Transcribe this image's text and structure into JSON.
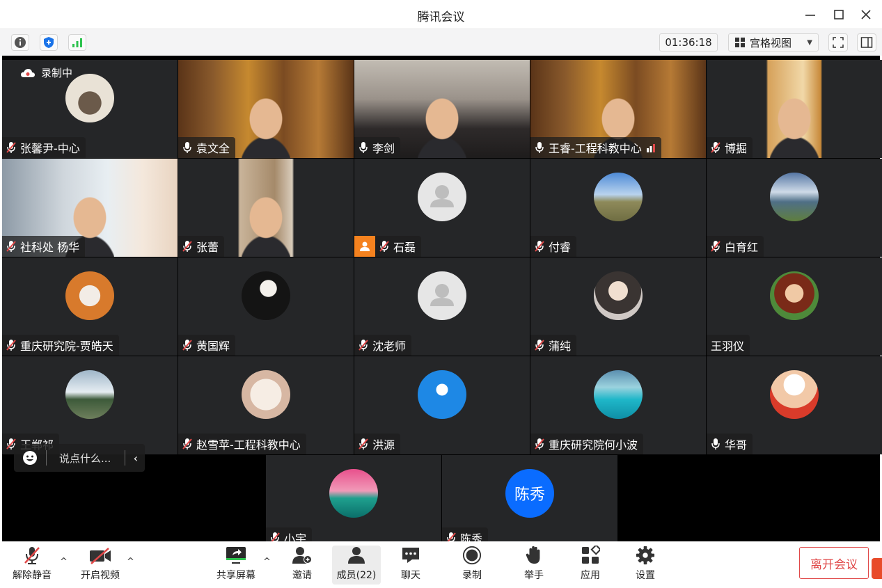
{
  "window": {
    "title": "腾讯会议"
  },
  "infobar": {
    "timer": "01:36:18",
    "view_label": "宫格视图"
  },
  "recording": {
    "label": "录制中"
  },
  "tiles": [
    {
      "name": "张馨尹-中心",
      "type": "avatar",
      "mic": "muted"
    },
    {
      "name": "袁文全",
      "type": "video",
      "mic": "on",
      "active": true
    },
    {
      "name": "李剑",
      "type": "video",
      "mic": "on"
    },
    {
      "name": "王睿-工程科教中心",
      "type": "video",
      "mic": "on"
    },
    {
      "name": "博掘",
      "type": "video",
      "mic": "muted"
    },
    {
      "name": "社科处 杨华",
      "type": "video",
      "mic": "muted"
    },
    {
      "name": "张蕾",
      "type": "video",
      "mic": "muted"
    },
    {
      "name": "石磊",
      "type": "default",
      "mic": "muted",
      "host": true
    },
    {
      "name": "付睿",
      "type": "avatar",
      "mic": "muted"
    },
    {
      "name": "白育红",
      "type": "avatar",
      "mic": "muted"
    },
    {
      "name": "重庆研究院-贾皓天",
      "type": "avatar",
      "mic": "muted"
    },
    {
      "name": "黄国辉",
      "type": "avatar",
      "mic": "muted"
    },
    {
      "name": "沈老师",
      "type": "default",
      "mic": "muted"
    },
    {
      "name": "蒲纯",
      "type": "avatar",
      "mic": "muted"
    },
    {
      "name": "王羽仪",
      "type": "avatar",
      "mic": "none"
    },
    {
      "name": "王郸祁",
      "type": "avatar",
      "mic": "muted"
    },
    {
      "name": "赵雪苹-工程科教中心",
      "type": "avatar",
      "mic": "muted"
    },
    {
      "name": "洪源",
      "type": "avatar",
      "mic": "muted"
    },
    {
      "name": "重庆研究院何小波",
      "type": "avatar",
      "mic": "muted"
    },
    {
      "name": "华哥",
      "type": "avatar",
      "mic": "on"
    }
  ],
  "bottom_tiles": [
    {
      "name": "小宇",
      "type": "avatar"
    },
    {
      "name": "陈秀",
      "type": "initials",
      "initials": "陈秀"
    }
  ],
  "chat": {
    "placeholder": "说点什么..."
  },
  "toolbar": {
    "unmute": "解除静音",
    "start_video": "开启视频",
    "share_screen": "共享屏幕",
    "invite": "邀请",
    "members": "成员(22)",
    "chat": "聊天",
    "record": "录制",
    "raise_hand": "举手",
    "apps": "应用",
    "settings": "设置",
    "leave": "离开会议"
  },
  "colors": {
    "tile_bg": "#252628",
    "active_border": "#3bbb5a",
    "leave_red": "#e04848",
    "initials_blue": "#0a6cff",
    "host_orange": "#f5821f"
  }
}
